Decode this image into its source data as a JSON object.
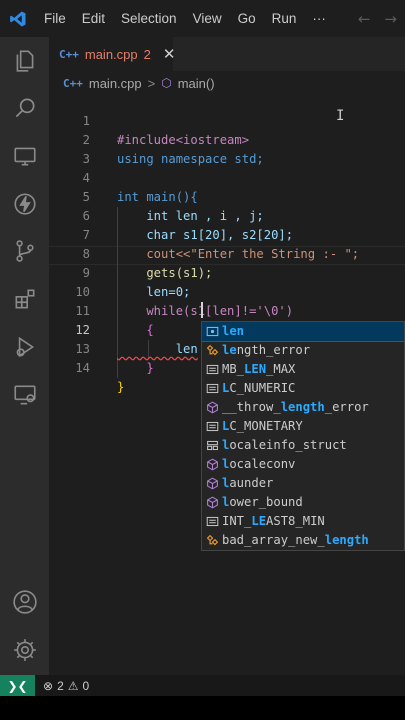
{
  "titlebar": {
    "menu": [
      "File",
      "Edit",
      "Selection",
      "View",
      "Go",
      "Run",
      "···"
    ],
    "back_icon": "arrow-left-icon",
    "forward_icon": "arrow-right-icon"
  },
  "activity_bar": {
    "items": [
      "explorer-icon",
      "search-icon",
      "remote-explorer-icon",
      "run-icon",
      "source-control-icon",
      "extensions-icon",
      "debug-icon",
      "remote-window-icon"
    ],
    "bottom": [
      "account-icon",
      "manage-gear-icon"
    ]
  },
  "tab": {
    "label": "main.cpp",
    "badge": "2",
    "close": "✕",
    "lang_glyph": "C++"
  },
  "breadcrumb": {
    "file": "main.cpp",
    "separator": ">",
    "symbol": "main()"
  },
  "code": {
    "line_numbers": [
      "1",
      "2",
      "3",
      "4",
      "5",
      "6",
      "7",
      "8",
      "9",
      "10",
      "11",
      "12",
      "13",
      "14"
    ],
    "lines": [
      "#include<iostream>",
      "using namespace std;",
      "",
      "int main(){",
      "    int len , i , j;",
      "    char s1[20], s2[20];",
      "    cout<<\"Enter the String :- \";",
      "    gets(s1);",
      "    len=0;",
      "    while(s1[len]!='\\0')",
      "    {",
      "        len",
      "    }",
      "}"
    ]
  },
  "suggestions": [
    {
      "pre": "",
      "match": "len",
      "post": "",
      "icon": "field-icon"
    },
    {
      "pre": "",
      "match": "le",
      "post": "ngth_error",
      "icon": "class-icon"
    },
    {
      "pre": "MB_",
      "match": "LEN",
      "post": "_MAX",
      "icon": "constant-icon"
    },
    {
      "pre": "",
      "match": "L",
      "post": "C_NUMERIC",
      "icon": "constant-icon"
    },
    {
      "pre": "__throw_",
      "match": "length",
      "post": "_error",
      "icon": "method-icon"
    },
    {
      "pre": "",
      "match": "L",
      "post": "C_MONETARY",
      "icon": "constant-icon"
    },
    {
      "pre": "",
      "match": "l",
      "post": "ocaleinfo_struct",
      "icon": "struct-icon"
    },
    {
      "pre": "",
      "match": "l",
      "post": "ocaleconv",
      "icon": "method-icon"
    },
    {
      "pre": "",
      "match": "l",
      "post": "aunder",
      "icon": "method-icon"
    },
    {
      "pre": "",
      "match": "l",
      "post": "ower_bound",
      "icon": "method-icon"
    },
    {
      "pre": "INT_",
      "match": "LE",
      "post": "AST8_MIN",
      "icon": "constant-icon"
    },
    {
      "pre": "bad_array_new_",
      "match": "length",
      "post": "",
      "icon": "class-icon"
    }
  ],
  "status": {
    "errors": "2",
    "warnings": "0"
  },
  "colors": {
    "accent": "#16825d",
    "selection": "#04395e",
    "match": "#2aaaff",
    "tab_modified": "#e37e6a"
  }
}
